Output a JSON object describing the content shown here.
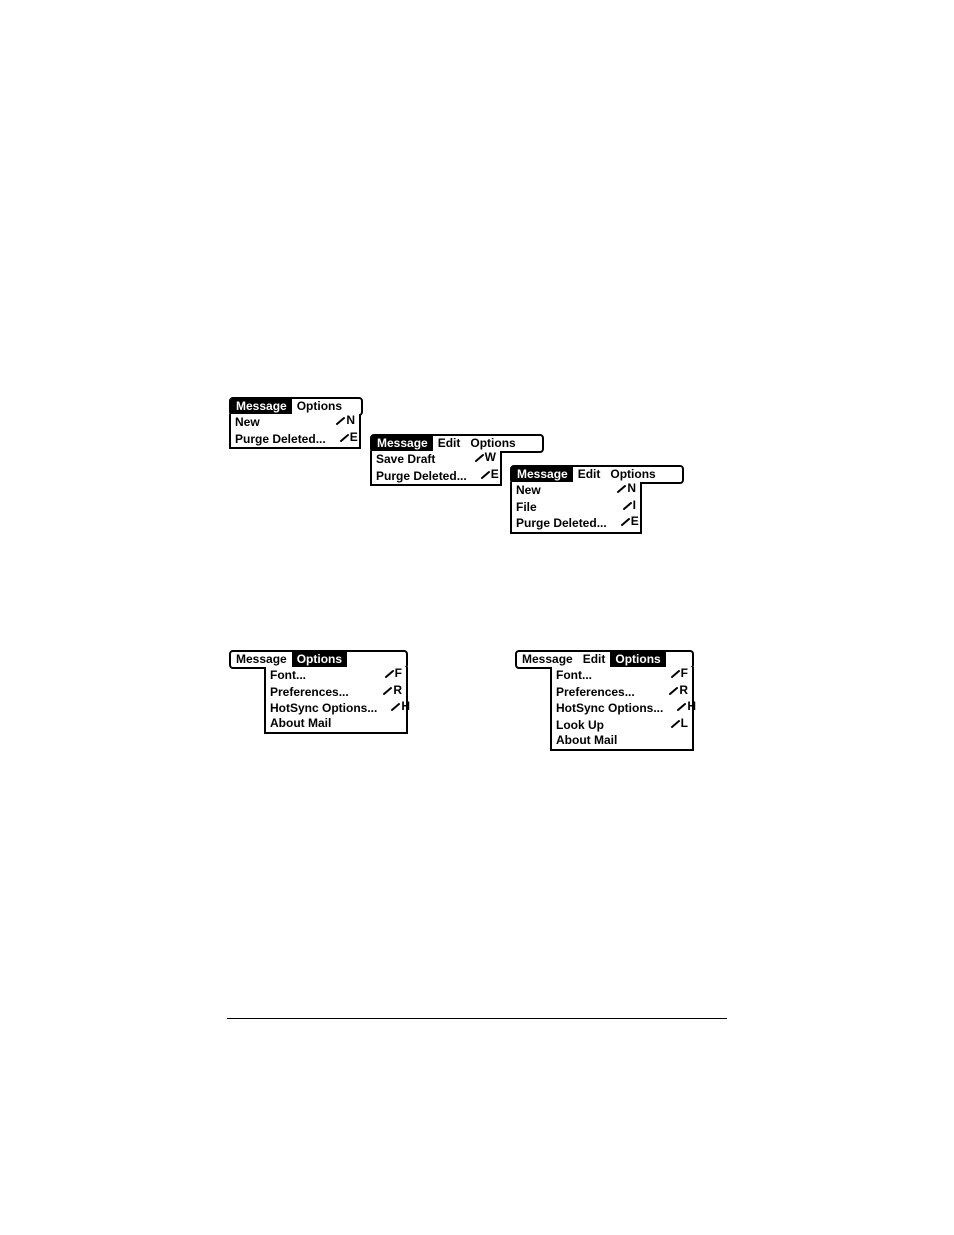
{
  "shortcut_glyph": "/",
  "menus": {
    "m1": {
      "bar": [
        {
          "label": "Message",
          "active": true
        },
        {
          "label": "Options",
          "active": false
        }
      ],
      "items": [
        {
          "label": "New",
          "sc": "N"
        },
        {
          "label": "Purge Deleted...",
          "sc": "E"
        }
      ]
    },
    "m2": {
      "bar": [
        {
          "label": "Message",
          "active": true
        },
        {
          "label": "Edit",
          "active": false
        },
        {
          "label": "Options",
          "active": false
        }
      ],
      "items": [
        {
          "label": "Save Draft",
          "sc": "W"
        },
        {
          "label": "Purge Deleted...",
          "sc": "E"
        }
      ]
    },
    "m3": {
      "bar": [
        {
          "label": "Message",
          "active": true
        },
        {
          "label": "Edit",
          "active": false
        },
        {
          "label": "Options",
          "active": false
        }
      ],
      "items": [
        {
          "label": "New",
          "sc": "N"
        },
        {
          "label": "File",
          "sc": "I"
        },
        {
          "label": "Purge Deleted...",
          "sc": "E"
        }
      ]
    },
    "m4": {
      "bar": [
        {
          "label": "Message",
          "active": false
        },
        {
          "label": "Options",
          "active": true
        }
      ],
      "items": [
        {
          "label": "Font...",
          "sc": "F"
        },
        {
          "label": "Preferences...",
          "sc": "R"
        },
        {
          "label": "HotSync Options...",
          "sc": "H"
        },
        {
          "label": "About Mail",
          "sc": ""
        }
      ]
    },
    "m5": {
      "bar": [
        {
          "label": "Message",
          "active": false
        },
        {
          "label": "Edit",
          "active": false
        },
        {
          "label": "Options",
          "active": true
        }
      ],
      "items": [
        {
          "label": "Font...",
          "sc": "F"
        },
        {
          "label": "Preferences...",
          "sc": "R"
        },
        {
          "label": "HotSync Options...",
          "sc": "H"
        },
        {
          "label": "Look Up",
          "sc": "L"
        },
        {
          "label": "About Mail",
          "sc": ""
        }
      ]
    }
  }
}
